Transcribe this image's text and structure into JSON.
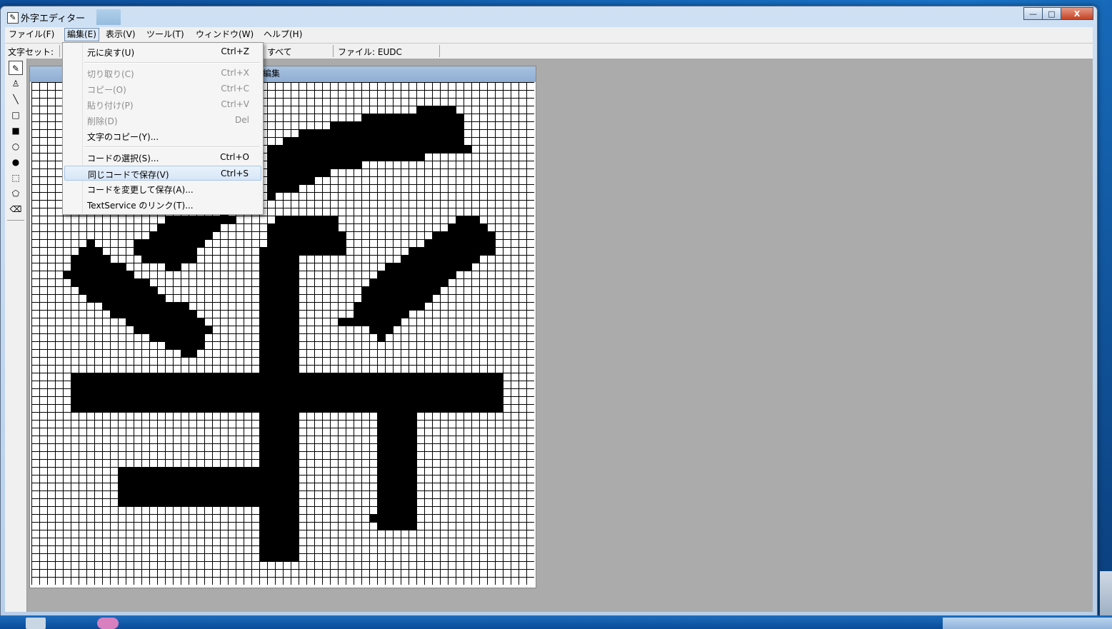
{
  "window": {
    "title": "外字エディター",
    "controls": {
      "minimize": "—",
      "maximize": "□",
      "close": "X"
    }
  },
  "menubar": [
    {
      "label": "ファイル(F)"
    },
    {
      "label": "編集(E)",
      "active": true
    },
    {
      "label": "表示(V)"
    },
    {
      "label": "ツール(T)"
    },
    {
      "label": "ウィンドウ(W)"
    },
    {
      "label": "ヘルプ(H)"
    }
  ],
  "statusbar": {
    "charset_label": "文字セット:",
    "font_value": "すべて",
    "file_label": "ファイル: EUDC"
  },
  "tools": [
    {
      "name": "pencil-icon",
      "glyph": "✎",
      "active": true
    },
    {
      "name": "brush-icon",
      "glyph": "♙"
    },
    {
      "name": "line-icon",
      "glyph": "╲"
    },
    {
      "name": "rectangle-outline-icon",
      "glyph": "□"
    },
    {
      "name": "rectangle-filled-icon",
      "glyph": "■"
    },
    {
      "name": "ellipse-outline-icon",
      "glyph": "○"
    },
    {
      "name": "ellipse-filled-icon",
      "glyph": "●"
    },
    {
      "name": "rect-select-icon",
      "glyph": "⬚"
    },
    {
      "name": "freeform-select-icon",
      "glyph": "⬠"
    },
    {
      "name": "eraser-icon",
      "glyph": "⌫"
    }
  ],
  "editor": {
    "title": "編集"
  },
  "edit_menu": {
    "items": [
      {
        "label": "元に戻す(U)",
        "shortcut": "Ctrl+Z",
        "disabled": false
      },
      {
        "separator": true
      },
      {
        "label": "切り取り(C)",
        "shortcut": "Ctrl+X",
        "disabled": true
      },
      {
        "label": "コピー(O)",
        "shortcut": "Ctrl+C",
        "disabled": true
      },
      {
        "label": "貼り付け(P)",
        "shortcut": "Ctrl+V",
        "disabled": true
      },
      {
        "label": "削除(D)",
        "shortcut": "Del",
        "disabled": true
      },
      {
        "label": "文字のコピー(Y)...",
        "shortcut": "",
        "disabled": false
      },
      {
        "separator": true
      },
      {
        "label": "コードの選択(S)...",
        "shortcut": "Ctrl+O",
        "disabled": false
      },
      {
        "label": "同じコードで保存(V)",
        "shortcut": "Ctrl+S",
        "disabled": false,
        "highlighted": true
      },
      {
        "label": "コードを変更して保存(A)...",
        "shortcut": "",
        "disabled": false
      },
      {
        "label": "TextService のリンク(T)...",
        "shortcut": "",
        "disabled": false
      }
    ]
  },
  "taskbar": {
    "icons": [
      "app-icon",
      "character-icon"
    ]
  }
}
